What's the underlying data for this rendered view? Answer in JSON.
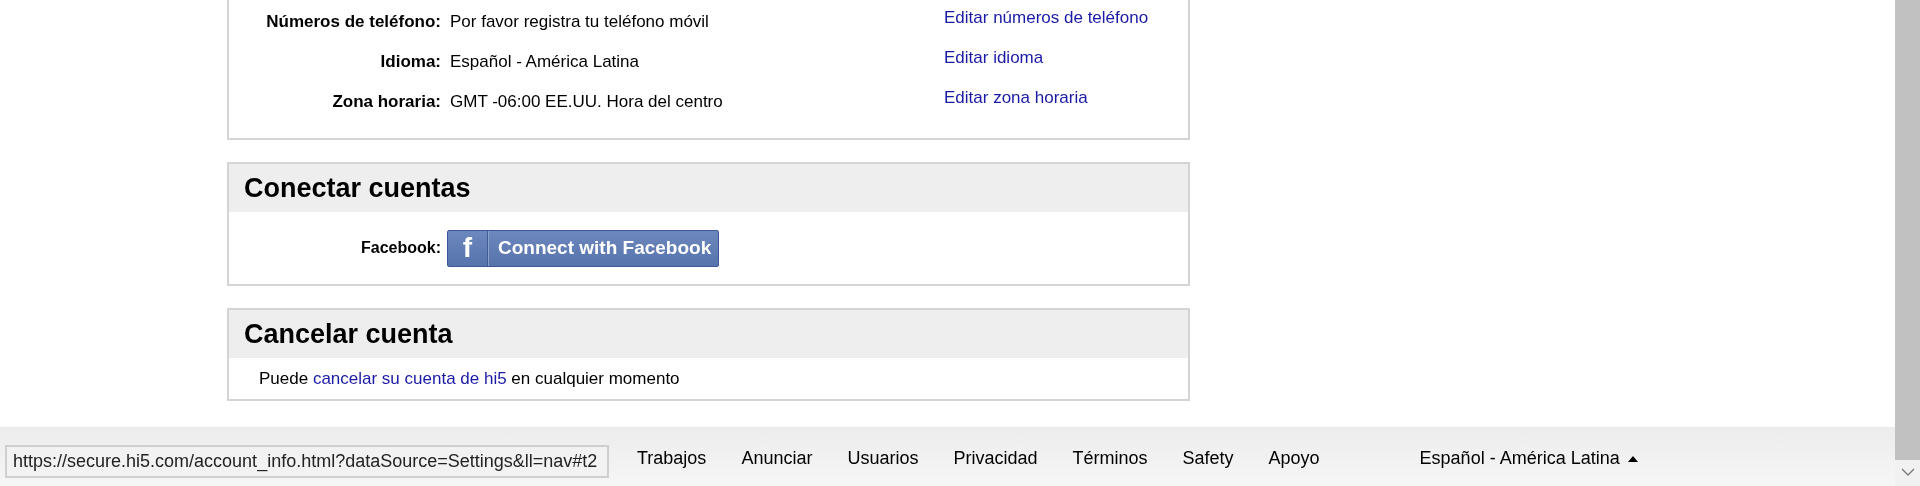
{
  "account_panel": {
    "rows": [
      {
        "label": "Números de teléfono:",
        "value": "Por favor registra tu teléfono móvil",
        "link": "Editar números de teléfono"
      },
      {
        "label": "Idioma:",
        "value": "Español - América Latina",
        "link": "Editar idioma"
      },
      {
        "label": "Zona horaria:",
        "value": "GMT -06:00 EE.UU. Hora del centro",
        "link": "Editar zona horaria"
      }
    ]
  },
  "connect_panel": {
    "title": "Conectar cuentas",
    "label": "Facebook:",
    "button": {
      "icon": "f",
      "label": "Connect with Facebook"
    }
  },
  "cancel_panel": {
    "title": "Cancelar cuenta",
    "before": "Puede",
    "link": "cancelar su cuenta de hi5",
    "after": "en cualquier momento"
  },
  "footer": {
    "links": [
      "Trabajos",
      "Anunciar",
      "Usuarios",
      "Privacidad",
      "Términos",
      "Safety",
      "Apoyo"
    ],
    "language": "Español - América Latina"
  },
  "status_bar": {
    "url": "https://secure.hi5.com/account_info.html?dataSource=Settings&ll=nav#t2"
  }
}
